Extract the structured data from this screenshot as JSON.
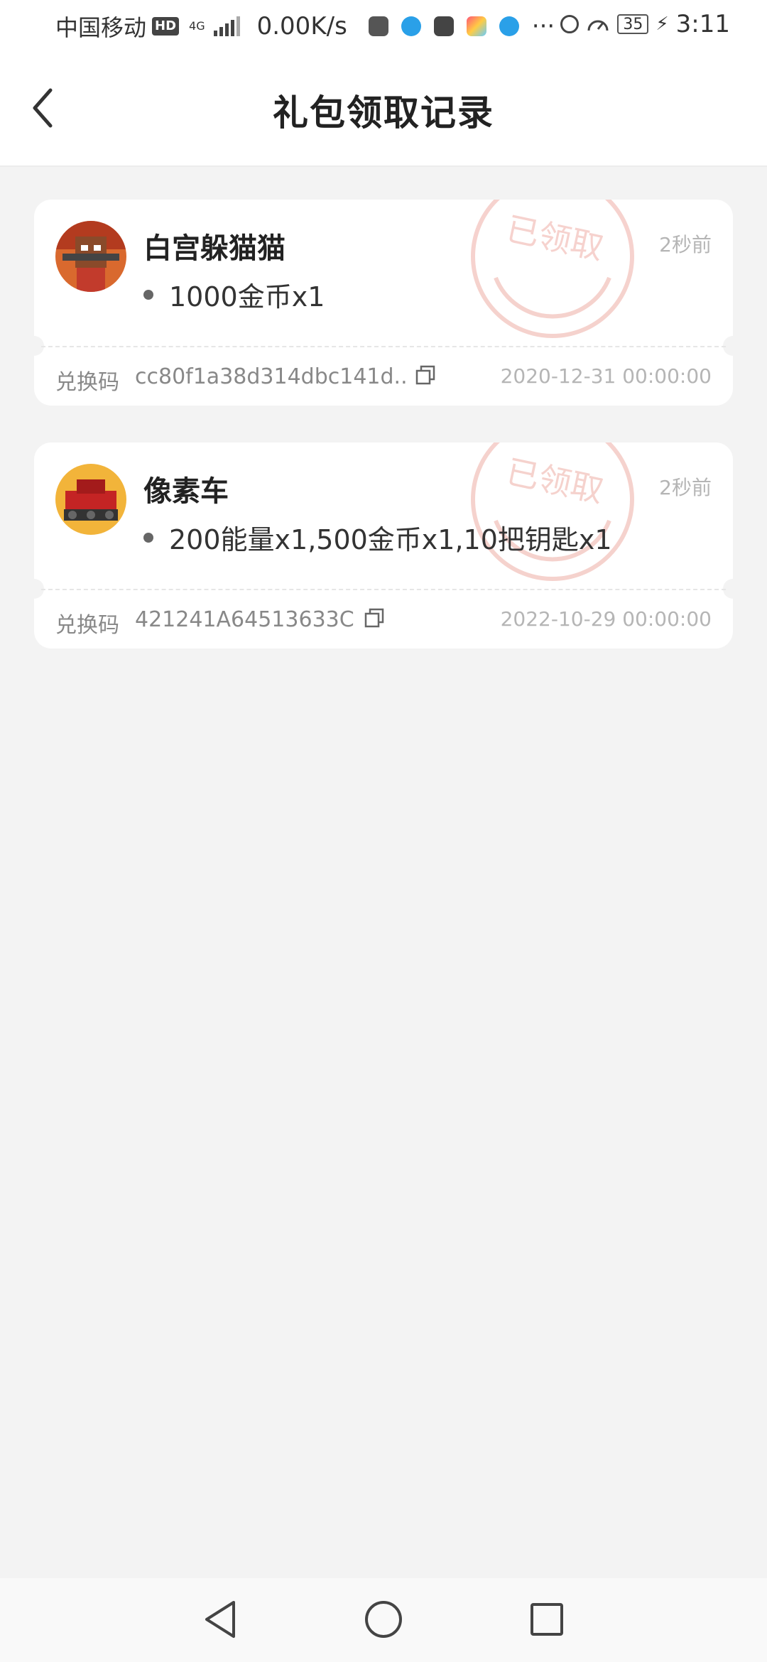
{
  "status_bar": {
    "carrier": "中国移动",
    "hd": "HD",
    "network": "4G",
    "speed": "0.00K/s",
    "more": "···",
    "battery": "35",
    "time": "3:11"
  },
  "header": {
    "title": "礼包领取记录",
    "back_icon": "chevron-left-icon"
  },
  "records": [
    {
      "game": "白宫躲猫猫",
      "item": "1000金币x1",
      "time_ago": "2秒前",
      "stamp_text": "已领取",
      "code_label": "兑换码",
      "code": "cc80f1a38d314dbc141d..",
      "expire": "2020-12-31 00:00:00",
      "avatar_color": "#d9692e"
    },
    {
      "game": "像素车",
      "item": "200能量x1,500金币x1,10把钥匙x1",
      "time_ago": "2秒前",
      "stamp_text": "已领取",
      "code_label": "兑换码",
      "code": "421241A64513633C",
      "expire": "2022-10-29 00:00:00",
      "avatar_color": "#f2b43a"
    }
  ],
  "colors": {
    "background": "#f3f3f3",
    "card": "#ffffff",
    "stamp": "#f0b5ad",
    "muted_text": "#b5b5b5"
  }
}
